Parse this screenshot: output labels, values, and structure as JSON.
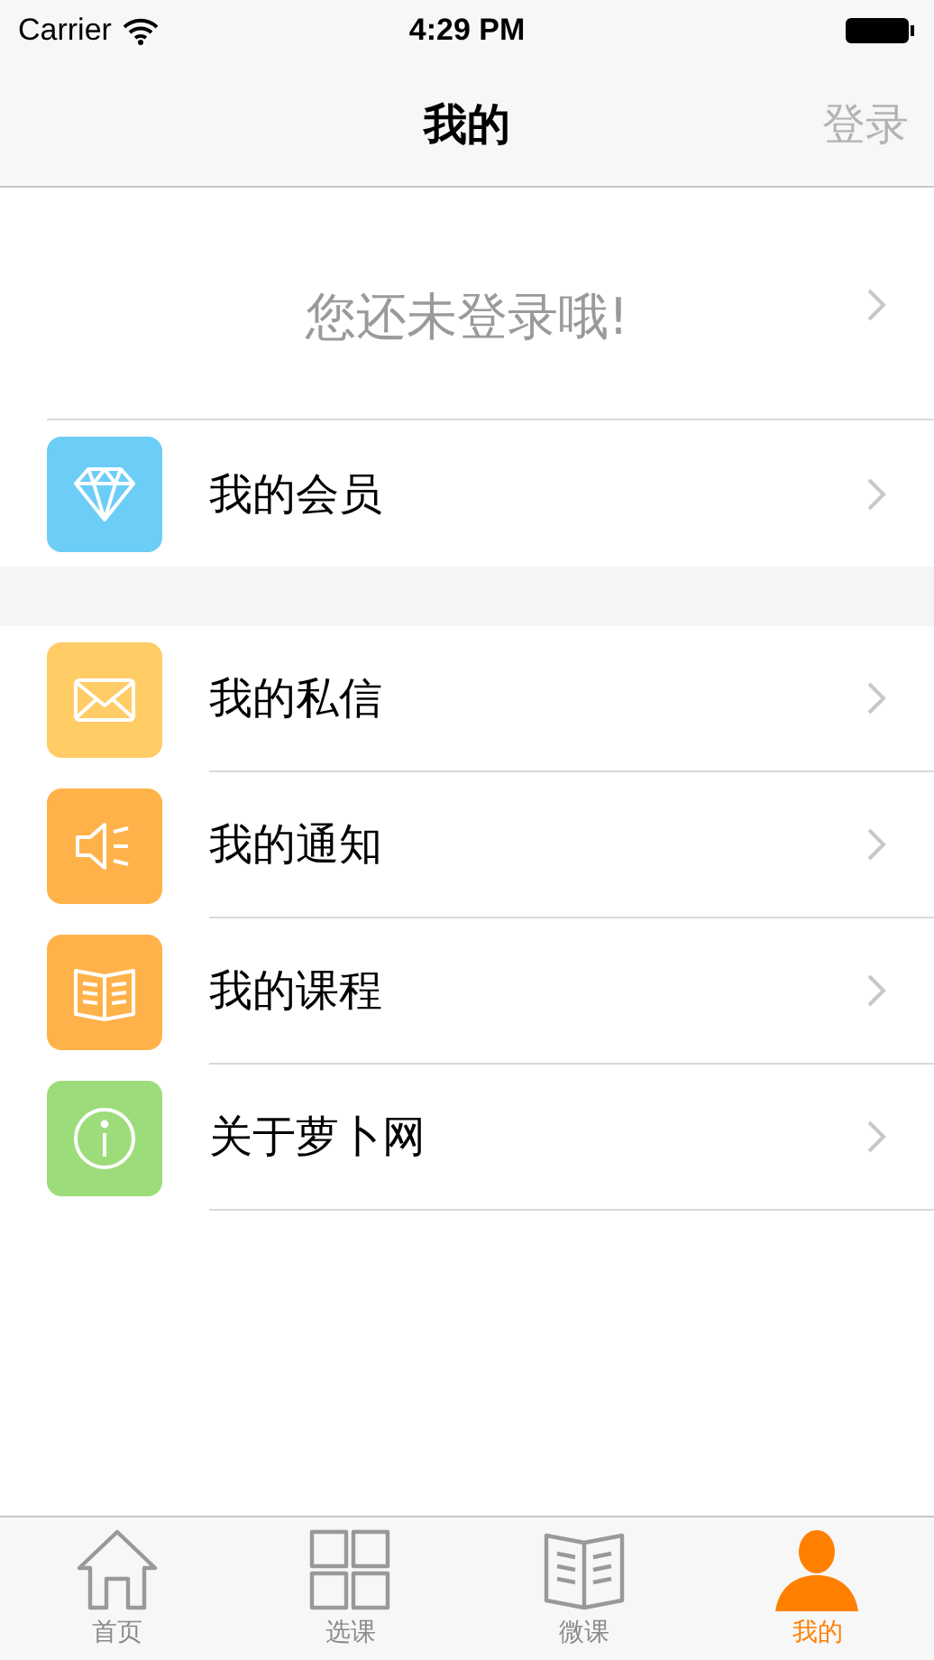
{
  "status_bar": {
    "carrier": "Carrier",
    "time": "4:29 PM"
  },
  "nav": {
    "title": "我的",
    "action": "登录"
  },
  "login_prompt": "您还未登录哦!",
  "sections": [
    {
      "items": [
        {
          "label": "我的会员",
          "kind": "diamond",
          "color": "#6ccdf7"
        }
      ]
    },
    {
      "items": [
        {
          "label": "我的私信",
          "kind": "mail",
          "color": "#ffcc66"
        },
        {
          "label": "我的通知",
          "kind": "speaker",
          "color": "#ffb24a"
        },
        {
          "label": "我的课程",
          "kind": "book",
          "color": "#ffb24a"
        },
        {
          "label": "关于萝卜网",
          "kind": "info",
          "color": "#9ddc7a"
        }
      ]
    }
  ],
  "tabs": [
    {
      "label": "首页",
      "kind": "home",
      "selected": false
    },
    {
      "label": "选课",
      "kind": "grid",
      "selected": false
    },
    {
      "label": "微课",
      "kind": "book",
      "selected": false
    },
    {
      "label": "我的",
      "kind": "person",
      "selected": true
    }
  ]
}
